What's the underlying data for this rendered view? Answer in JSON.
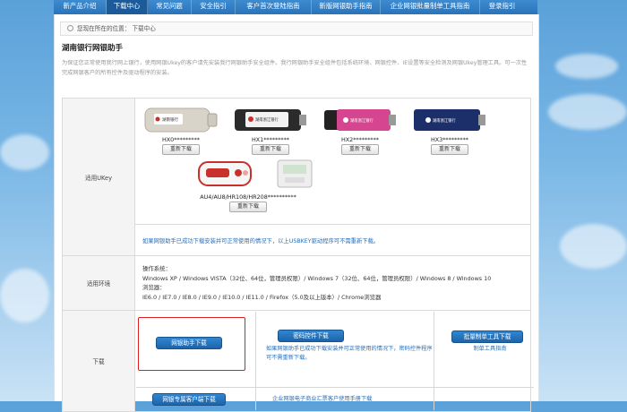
{
  "nav": {
    "items": [
      "新产品介绍",
      "下载中心",
      "常见问题",
      "安全指引",
      "客户首次登陆指南",
      "新版网银助手指南",
      "企业网银批量制单工具指南",
      "登录指引"
    ],
    "active_index": 1
  },
  "breadcrumb": {
    "prefix": "您现在所在的位置：",
    "current": "下载中心"
  },
  "page": {
    "title": "湖南银行网银助手",
    "intro": "为保证您正常使用我行网上银行，使用网银Ukey的客户请先安装我行网银助手安全组件。我行网银助手安全组件包括系统环境、网银控件、IE设置等安全检测及网银Ukey管理工具。可一次性完成网银客户的所有控件及驱动程序的安装。"
  },
  "ukey": {
    "label": "适用UKey",
    "products": [
      {
        "name": "HX0*********",
        "button": "重新下载",
        "card_text": "湖南银行"
      },
      {
        "name": "HX1*********",
        "button": "重新下载",
        "card_text": "湖南浙江银行"
      },
      {
        "name": "HX2*********",
        "button": "重新下载",
        "card_text": "湖南浙江银行"
      },
      {
        "name": "HX3*********",
        "button": "重新下载",
        "card_text": "湖南浙江银行"
      },
      {
        "name": "AU4/AU8/HR108/HR208**********",
        "button": "重新下载",
        "card_text": ""
      }
    ]
  },
  "note": "如果网银助手已成功下载安装并可正常使用的情况下，以上USBKEY驱动程序可不需重新下载。",
  "env": {
    "label": "适用环境",
    "os_title": "操作系统：",
    "os_list": "Windows XP / Windows VISTA（32位、64位，管理员权限）/ Windows 7（32位、64位，管理员权限）/ Windows 8 / Windows 10",
    "browser_title": "浏览器：",
    "browser_list": "IE6.0 / IE7.0 / IE8.0 / IE9.0 / IE10.0 / IE11.0 / Firefox（5.0及以上版本）/ Chrome浏览器"
  },
  "download": {
    "label": "下载",
    "helper_button": "网银助手下载",
    "security_button": "密码控件下载",
    "security_text": "如果网银助手已成功下载安装并可正常使用的情况下，密码控件程序可不需重新下载。",
    "batch_button": "批量制单工具下载",
    "batch_link": "制单工具指南",
    "client_button": "网银专属客户端下载",
    "manual_link": "企业网银电子商业汇票客户使用手册下载"
  },
  "colors": {
    "nav": "#2a73b9",
    "nav_active": "#1c5b99",
    "button": "#1d64a8",
    "link": "#2b6fb6",
    "highlight": "#e02020"
  }
}
